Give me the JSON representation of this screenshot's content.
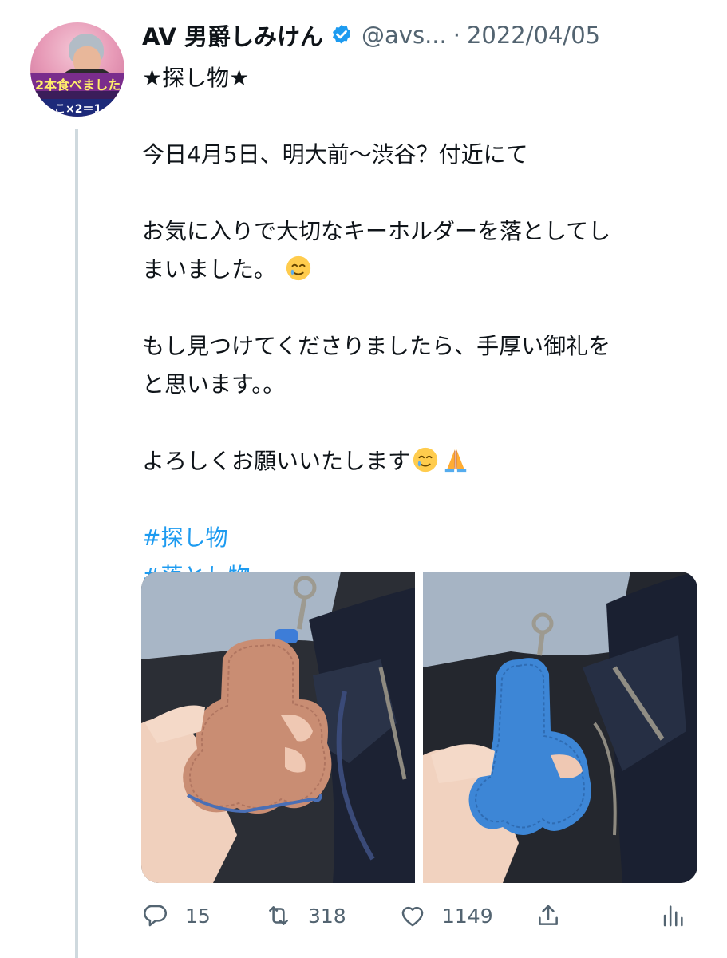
{
  "tweet": {
    "author": {
      "display_name": "AV 男爵しみけん",
      "handle": "@avs...",
      "verified": true,
      "avatar_caption_top": "2本食べました",
      "avatar_caption_bottom": "こ×2＝1"
    },
    "separator": "·",
    "date": "2022/04/05",
    "text_lines": [
      "★探し物★",
      "今日4月5日、明大前〜渋谷？付近にて",
      "お気に入りで大切なキーホルダーを落としてし",
      "まいました。",
      "もし見つけてくださりましたら、手厚い御礼を",
      "と思います。。",
      "よろしくお願いいたします"
    ],
    "hashtags": [
      "#探し物",
      "#落とし物"
    ],
    "media": [
      {
        "description": "hand holding tan leather keyholder",
        "color": "#c98d73"
      },
      {
        "description": "hand holding blue leather keyholder",
        "color": "#3d86d6"
      }
    ],
    "stats": {
      "replies": "15",
      "retweets": "318",
      "likes": "1149"
    },
    "icons": {
      "reply": "reply-icon",
      "retweet": "retweet-icon",
      "like": "like-icon",
      "share": "share-icon",
      "analytics": "analytics-icon",
      "emoji_tear": "face-holding-back-tears-emoji",
      "emoji_pray": "folded-hands-emoji"
    },
    "colors": {
      "link": "#1d9bf0",
      "muted": "#536471",
      "verified": "#1d9bf0",
      "thread_line": "#cfd9de"
    }
  }
}
